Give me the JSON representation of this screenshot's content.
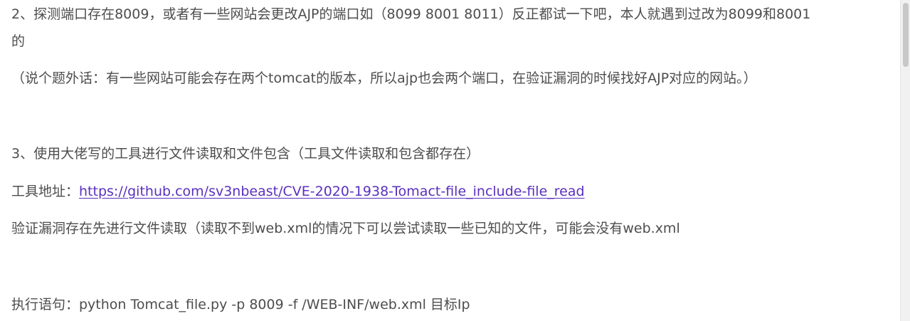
{
  "article": {
    "p1_line1": "2、探测端口存在8009，或者有一些网站会更改AJP的端口如（8099 8001 8011）反正都试一下吧，本人就遇到过改为8099和8001",
    "p1_line2": "的",
    "p2": "（说个题外话：有一些网站可能会存在两个tomcat的版本，所以ajp也会两个端口，在验证漏洞的时候找好AJP对应的网站。）",
    "p3": "3、使用大佬写的工具进行文件读取和文件包含（工具文件读取和包含都存在）",
    "p4_label": "工具地址：",
    "p4_link": "https://github.com/sv3nbeast/CVE-2020-1938-Tomact-file_include-file_read",
    "p5": "验证漏洞存在先进行文件读取（读取不到web.xml的情况下可以尝试读取一些已知的文件，可能会没有web.xml",
    "p6": "执行语句：python Tomcat_file.py -p 8009 -f /WEB-INF/web.xml 目标Ip"
  },
  "colors": {
    "text": "#4d4d4d",
    "link": "#5a2fbf",
    "background": "#ffffff"
  }
}
